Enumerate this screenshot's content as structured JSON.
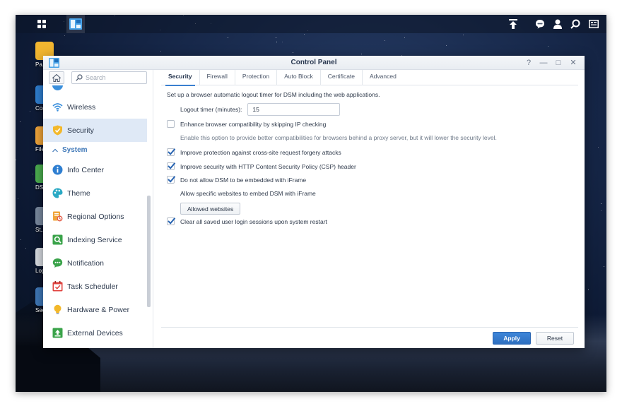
{
  "taskbar": {
    "left_icons": [
      "main-menu-icon",
      "control-panel-app-icon"
    ],
    "right_icons": [
      "upload-icon",
      "notifications-icon",
      "user-icon",
      "search-icon",
      "widgets-icon"
    ]
  },
  "desktop": {
    "icons": [
      {
        "label": "Pa... Ce...",
        "icon": "package-center-icon",
        "color": "#f2b630"
      },
      {
        "label": "Cont...",
        "icon": "control-panel-icon",
        "color": "#2f7fd1"
      },
      {
        "label": "File...",
        "icon": "file-station-icon",
        "color": "#f0a53a"
      },
      {
        "label": "DS...",
        "icon": "dsm-help-icon",
        "color": "#4caf50"
      },
      {
        "label": "St... Ma...",
        "icon": "storage-manager-icon",
        "color": "#7a8aa0"
      },
      {
        "label": "Log...",
        "icon": "log-center-icon",
        "color": "#d9dde3"
      },
      {
        "label": "Securi...",
        "icon": "security-advisor-icon",
        "color": "#3f78b8"
      }
    ]
  },
  "window": {
    "title": "Control Panel",
    "controls": [
      "help-icon",
      "minimize-icon",
      "maximize-icon",
      "close-icon"
    ],
    "control_glyphs": [
      "?",
      "—",
      "□",
      "✕"
    ]
  },
  "sidebar": {
    "search_placeholder": "Search",
    "items": [
      {
        "label": "Wireless",
        "icon": "wireless-icon",
        "active": false
      },
      {
        "label": "Security",
        "icon": "security-shield-icon",
        "active": true
      }
    ],
    "group": {
      "label": "System",
      "expanded": true
    },
    "system_items": [
      {
        "label": "Info Center",
        "icon": "info-center-icon"
      },
      {
        "label": "Theme",
        "icon": "theme-icon"
      },
      {
        "label": "Regional Options",
        "icon": "regional-options-icon"
      },
      {
        "label": "Indexing Service",
        "icon": "indexing-service-icon"
      },
      {
        "label": "Notification",
        "icon": "notification-icon"
      },
      {
        "label": "Task Scheduler",
        "icon": "task-scheduler-icon"
      },
      {
        "label": "Hardware & Power",
        "icon": "hardware-power-icon"
      },
      {
        "label": "External Devices",
        "icon": "external-devices-icon"
      }
    ]
  },
  "tabs": [
    {
      "label": "Security",
      "active": true
    },
    {
      "label": "Firewall",
      "active": false
    },
    {
      "label": "Protection",
      "active": false
    },
    {
      "label": "Auto Block",
      "active": false
    },
    {
      "label": "Certificate",
      "active": false
    },
    {
      "label": "Advanced",
      "active": false
    }
  ],
  "security": {
    "logout_description": "Set up a browser automatic logout timer for DSM including the web applications.",
    "logout_timer_label": "Logout timer (minutes):",
    "logout_timer_value": "15",
    "options": [
      {
        "label": "Enhance browser compatibility by skipping IP checking",
        "checked": false
      },
      {
        "label": "Improve protection against cross-site request forgery attacks",
        "checked": true
      },
      {
        "label": "Improve security with HTTP Content Security Policy (CSP) header",
        "checked": true
      },
      {
        "label": "Do not allow DSM to be embedded with iFrame",
        "checked": true
      },
      {
        "label": "Clear all saved user login sessions upon system restart",
        "checked": true
      }
    ],
    "compat_note": "Enable this option to provide better compatibilities for browsers behind a proxy server, but it will lower the security level.",
    "iframe_note": "Allow specific websites to embed DSM with iFrame",
    "allowed_websites_label": "Allowed websites"
  },
  "footer": {
    "apply_label": "Apply",
    "reset_label": "Reset"
  },
  "colors": {
    "accent": "#3a7fd0",
    "active_item_bg": "#dfe9f6",
    "group_label": "#3f78b8"
  }
}
